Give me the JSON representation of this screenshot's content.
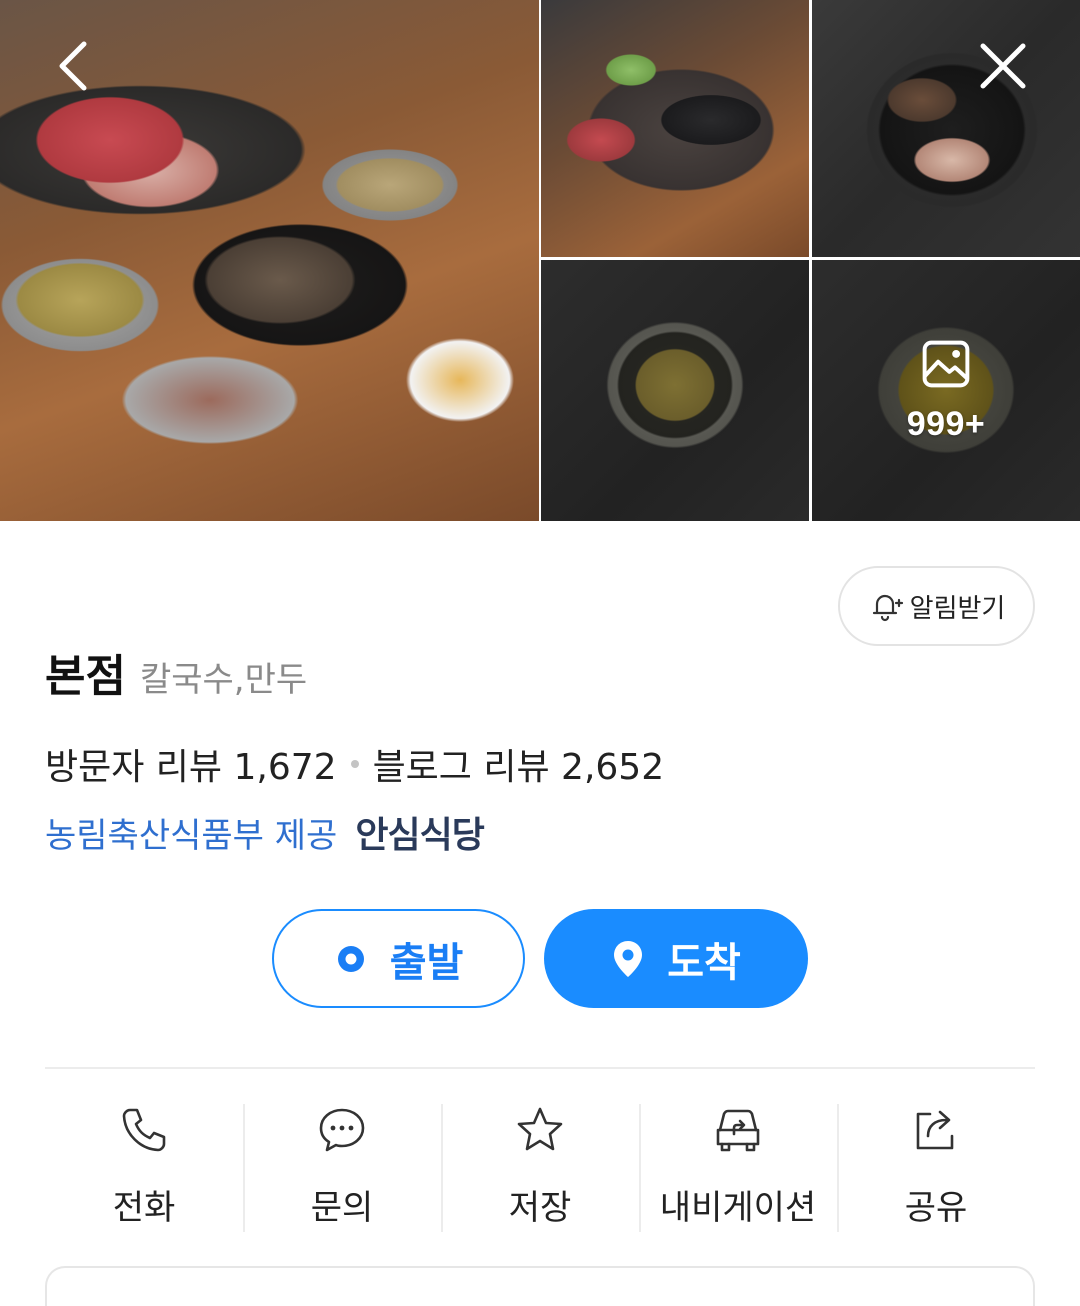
{
  "gallery": {
    "photo_count": "999+",
    "icons": {
      "back": "chevron-left-icon",
      "close": "close-icon",
      "photos": "image-icon"
    }
  },
  "notify": {
    "label": "알림받기",
    "icon": "bell-plus-icon"
  },
  "place": {
    "name": "본점",
    "category": "칼국수,만두"
  },
  "reviews": {
    "visitor": "방문자 리뷰 1,672",
    "blog": "블로그 리뷰 2,652"
  },
  "provider": {
    "text": "농림축산식품부 제공",
    "badge": "안심식당"
  },
  "route": {
    "depart_label": "출발",
    "arrive_label": "도착",
    "accent": "#1a8cff"
  },
  "actions": [
    {
      "label": "전화",
      "icon": "phone-icon"
    },
    {
      "label": "문의",
      "icon": "chat-icon"
    },
    {
      "label": "저장",
      "icon": "star-icon"
    },
    {
      "label": "내비게이션",
      "icon": "car-navigation-icon"
    },
    {
      "label": "공유",
      "icon": "share-icon"
    }
  ]
}
